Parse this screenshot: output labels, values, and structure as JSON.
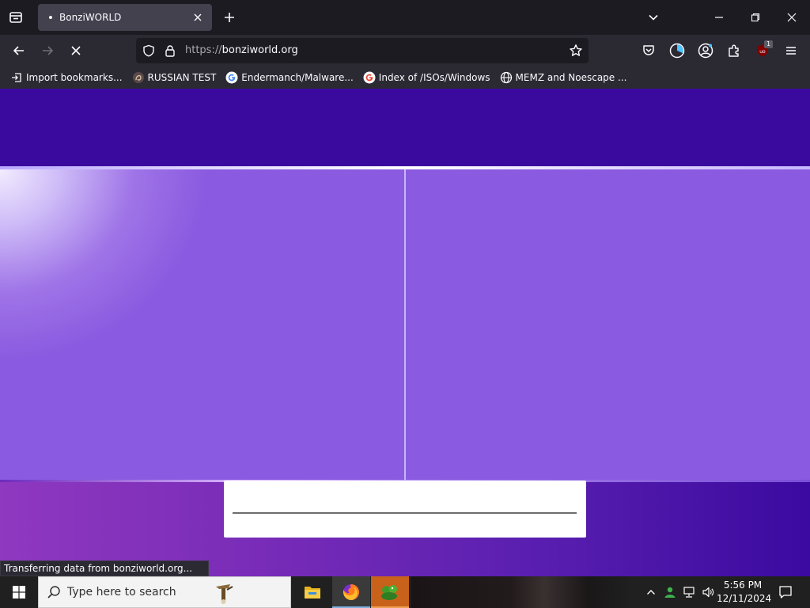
{
  "browser": {
    "tab": {
      "title": "BonziWORLD"
    },
    "url": {
      "protocol": "https://",
      "host": "bonziworld.org"
    },
    "extension_badge": "1",
    "bookmarks": [
      {
        "label": "Import bookmarks...",
        "icon": "import-icon"
      },
      {
        "label": "RUSSIAN TEST",
        "icon": "site-favicon"
      },
      {
        "label": "Endermanch/Malware...",
        "icon": "google-icon"
      },
      {
        "label": "Index of /ISOs/Windows",
        "icon": "google-icon"
      },
      {
        "label": "MEMZ and Noescape ...",
        "icon": "globe-icon"
      }
    ],
    "status": "Transferring data from bonziworld.org..."
  },
  "page": {
    "login": {
      "name_value": ""
    },
    "colors": {
      "header": "#3a0a9e",
      "stage": "#8a5be0",
      "footer_left": "#8f38c0",
      "footer_right": "#3b0aa0"
    }
  },
  "taskbar": {
    "search_placeholder": "Type here to search",
    "apps": [
      "file-explorer-icon",
      "firefox-icon",
      "bonzi-icon"
    ],
    "clock": {
      "time": "5:56 PM",
      "date": "12/11/2024"
    }
  }
}
